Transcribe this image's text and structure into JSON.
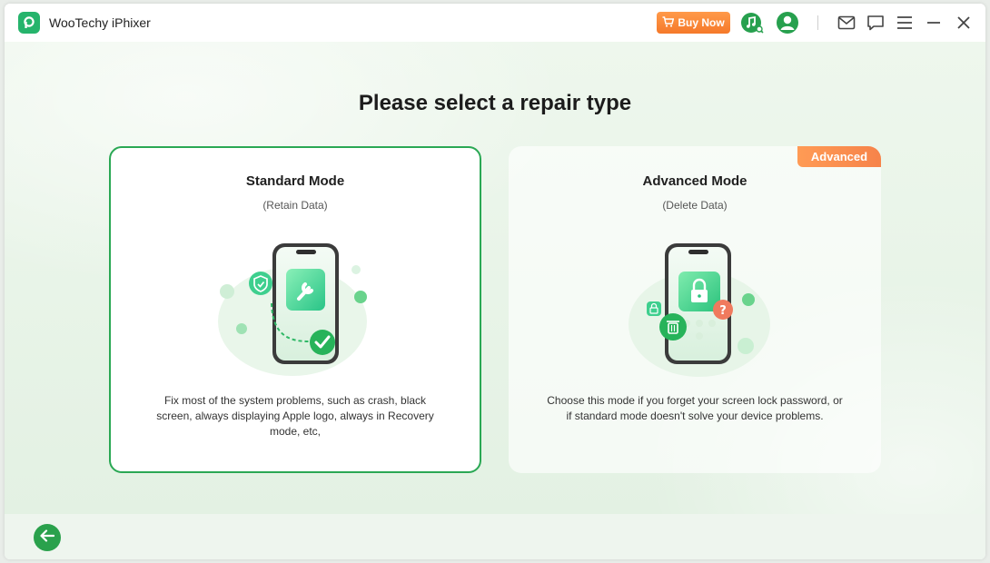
{
  "app": {
    "title": "WooTechy iPhixer",
    "buy_now_label": "Buy Now",
    "icons": [
      "cart-icon",
      "music-search-icon",
      "user-avatar-icon",
      "mail-icon",
      "chat-icon",
      "menu-icon",
      "minimize-icon",
      "close-icon"
    ]
  },
  "page": {
    "title": "Please select a repair type"
  },
  "modes": {
    "standard": {
      "title": "Standard Mode",
      "subtitle": "(Retain Data)",
      "description": "Fix most of the system problems, such as crash, black screen, always displaying Apple logo, always in Recovery mode, etc,",
      "selected": true
    },
    "advanced": {
      "title": "Advanced Mode",
      "subtitle": "(Delete Data)",
      "badge": "Advanced",
      "description": "Choose this mode if you forget your screen lock password, or if standard mode doesn't solve your device problems.",
      "selected": false
    }
  },
  "colors": {
    "brand_green": "#2aa854",
    "buy_orange": "#f5792a",
    "badge_orange": "#f6834a",
    "background": "#e6f2e5"
  }
}
